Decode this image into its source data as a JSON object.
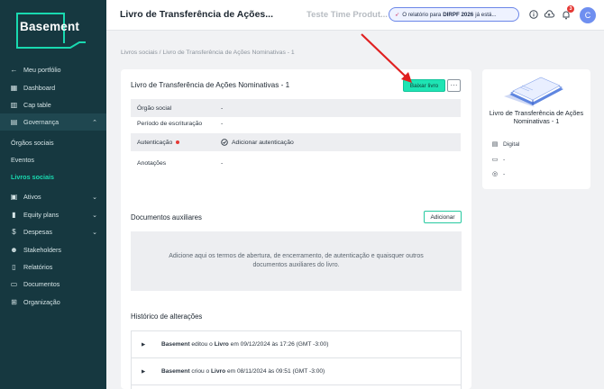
{
  "sidebar": {
    "logo": "Basement",
    "items": [
      {
        "icon": "arrow-left-icon",
        "label": "Meu portfólio"
      },
      {
        "icon": "dashboard-icon",
        "label": "Dashboard"
      },
      {
        "icon": "table-icon",
        "label": "Cap table"
      },
      {
        "icon": "book-icon",
        "label": "Governança"
      },
      {
        "icon": "briefcase-icon",
        "label": "Ativos"
      },
      {
        "icon": "chart-icon",
        "label": "Equity plans"
      },
      {
        "icon": "dollar-icon",
        "label": "Despesas"
      },
      {
        "icon": "people-icon",
        "label": "Stakeholders"
      },
      {
        "icon": "report-icon",
        "label": "Relatórios"
      },
      {
        "icon": "folder-icon",
        "label": "Documentos"
      },
      {
        "icon": "org-icon",
        "label": "Organização"
      }
    ],
    "sub_items": [
      "Órgãos sociais",
      "Eventos",
      "Livros sociais"
    ],
    "active_sub": "Livros sociais"
  },
  "header": {
    "title": "Livro de Transferência de Ações...",
    "company": "Teste Time Produt...",
    "notice_prefix": "O relatório para",
    "notice_bold": "DIRPF 2026",
    "notice_suffix": "já está...",
    "notification_count": "3",
    "avatar_initial": "C"
  },
  "breadcrumb": "Livros sociais  /  Livro de Transferência de Ações Nominativas - 1",
  "card": {
    "title": "Livro de Transferência de Ações Nominativas - 1",
    "download_button": "Baixar livro",
    "more_button": "···",
    "rows": [
      {
        "label": "Órgão social",
        "value": "-"
      },
      {
        "label": "Período de escrituração",
        "value": "-"
      },
      {
        "label": "Autenticação",
        "value": "Adicionar autenticação"
      },
      {
        "label": "Anotações",
        "value": "-"
      }
    ]
  },
  "aux": {
    "title": "Documentos auxiliares",
    "add_button": "Adicionar",
    "empty_text": "Adicione aqui os termos de abertura, de encerramento, de autenticação e quaisquer outros documentos auxiliares do livro."
  },
  "history": {
    "title": "Histórico de alterações",
    "entries": [
      {
        "actor": "Basement",
        "action": "editou o",
        "object": "Livro",
        "when": "em 09/12/2024 às 17:26 (GMT -3:00)"
      },
      {
        "actor": "Basement",
        "action": "criou o",
        "object": "Livro",
        "when": "em 08/11/2024 às 09:51 (GMT -3:00)"
      }
    ]
  },
  "side_card": {
    "title": "Livro de Transferência de Ações Nominativas - 1",
    "type": "Digital",
    "date": "-",
    "status": "-"
  },
  "colors": {
    "sidebar_bg": "#163840",
    "accent": "#1ee4b4",
    "alert_red": "#e53935",
    "notice_border": "#6b86e8"
  }
}
